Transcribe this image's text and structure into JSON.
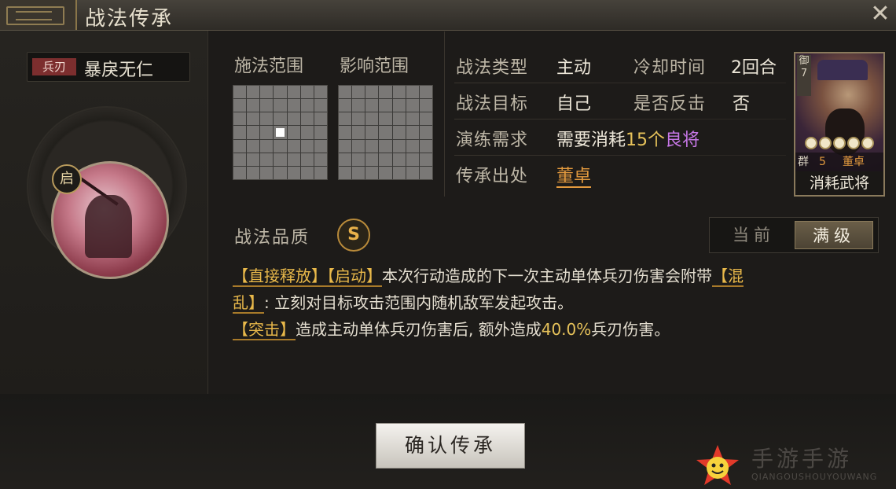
{
  "window": {
    "title": "战法传承",
    "close_label": "✕"
  },
  "skill": {
    "type_tag": "兵刃",
    "name": "暴戾无仁",
    "start_badge": "启"
  },
  "ranges": {
    "cast_label": "施法范围",
    "effect_label": "影响范围"
  },
  "info": {
    "type_label": "战法类型",
    "type_value": "主动",
    "cooldown_label": "冷却时间",
    "cooldown_value": "2回合",
    "target_label": "战法目标",
    "target_value": "自己",
    "counter_label": "是否反击",
    "counter_value": "否",
    "req_label": "演练需求",
    "req_prefix": "需要消耗",
    "req_count": "15个",
    "req_item": "良将",
    "source_label": "传承出处",
    "source_value": "董卓"
  },
  "general_card": {
    "side_tag": "御\n7",
    "faction": "群",
    "cost": "5",
    "name": "董卓",
    "stars": 5,
    "consume_label": "消耗武将"
  },
  "quality": {
    "label": "战法品质",
    "grade": "S"
  },
  "toggle": {
    "current": "当前",
    "max": "满级",
    "selected": "max"
  },
  "description": {
    "kw_direct": "【直接释放】",
    "kw_start": "【启动】",
    "text1": "本次行动造成的下一次主动单体兵刃伤害会附带",
    "kw_chaos_a": "【混",
    "kw_chaos_b": "乱】",
    "text2": ": 立刻对目标攻击范围内随机敌军发起攻击。",
    "kw_assault": "【突击】",
    "text3": "造成主动单体兵刃伤害后, 额外造成",
    "pct": "40.0%",
    "text4": "兵刃伤害。"
  },
  "confirm_button": "确认传承",
  "watermark": {
    "text": "手游手游",
    "sub": "QIANGOUSHOUYOUWANG"
  },
  "colors": {
    "gold": "#e6c25a",
    "purple": "#c878e8",
    "orange": "#e39a3e"
  }
}
